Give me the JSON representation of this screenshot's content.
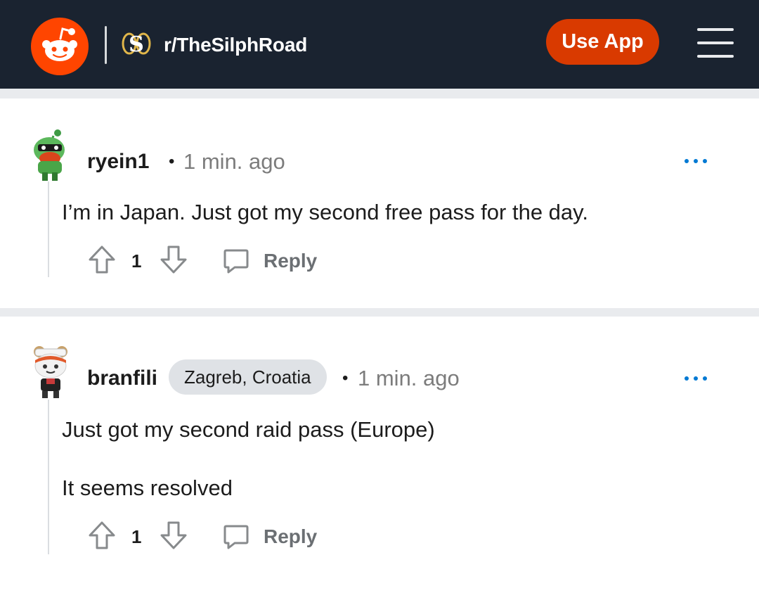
{
  "header": {
    "subreddit": "r/TheSilphRoad",
    "use_app_label": "Use App",
    "brand_color": "#ff4500",
    "button_color": "#d93a00",
    "background": "#1a2330"
  },
  "comments": [
    {
      "username": "ryein1",
      "flair": "",
      "separator": "•",
      "time": "1 min. ago",
      "body": [
        "I’m in Japan. Just got my second free pass for the day."
      ],
      "score": "1",
      "reply_label": "Reply"
    },
    {
      "username": "branfili",
      "flair": "Zagreb, Croatia",
      "separator": "•",
      "time": "1 min. ago",
      "body": [
        "Just got my second raid pass (Europe)",
        "It seems resolved"
      ],
      "score": "1",
      "reply_label": "Reply"
    }
  ]
}
